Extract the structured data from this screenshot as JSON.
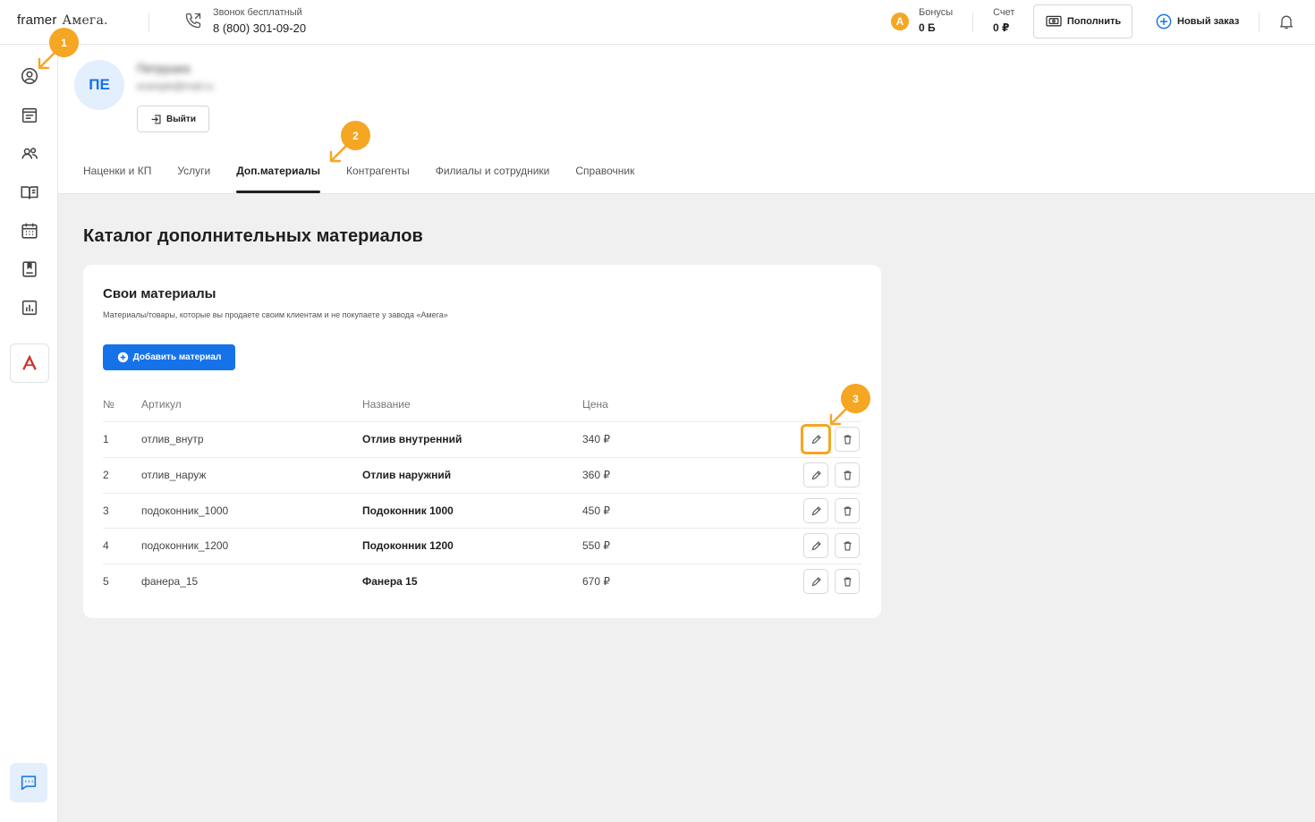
{
  "header": {
    "logo_brand": "framer",
    "logo_partner": "Амега.",
    "phone_label": "Звонок бесплатный",
    "phone_number": "8 (800) 301-09-20",
    "bonus_badge": "А",
    "bonus_label": "Бонусы",
    "bonus_value": "0 Б",
    "account_label": "Счет",
    "account_value": "0 ₽",
    "topup_label": "Пополнить",
    "new_order_label": "Новый заказ"
  },
  "sidebar": {
    "items": [
      "user-circle-icon",
      "order-list-icon",
      "users-icon",
      "catalog-book-icon",
      "calendar-icon",
      "bookmark-icon",
      "bar-chart-icon"
    ],
    "brand_letter": "A",
    "chat": "chat-icon"
  },
  "profile": {
    "initials": "ПЕ",
    "name": "Петрушка",
    "email": "example@mail.ru",
    "logout_label": "Выйти"
  },
  "tabs": [
    {
      "label": "Наценки и КП",
      "active": false
    },
    {
      "label": "Услуги",
      "active": false
    },
    {
      "label": "Доп.материалы",
      "active": true
    },
    {
      "label": "Контрагенты",
      "active": false
    },
    {
      "label": "Филиалы и сотрудники",
      "active": false
    },
    {
      "label": "Справочник",
      "active": false
    }
  ],
  "main": {
    "page_title": "Каталог дополнительных материалов",
    "card_title": "Свои материалы",
    "card_subtitle": "Материалы/товары, которые вы продаете своим клиентам и не покупаете у завода «Амега»",
    "add_button": "Добавить материал",
    "columns": [
      "№",
      "Артикул",
      "Название",
      "Цена"
    ],
    "rows": [
      {
        "num": "1",
        "sku": "отлив_внутр",
        "name": "Отлив внутренний",
        "price": "340 ₽"
      },
      {
        "num": "2",
        "sku": "отлив_наруж",
        "name": "Отлив наружний",
        "price": "360 ₽"
      },
      {
        "num": "3",
        "sku": "подоконник_1000",
        "name": "Подоконник 1000",
        "price": "450 ₽"
      },
      {
        "num": "4",
        "sku": "подоконник_1200",
        "name": "Подоконник 1200",
        "price": "550 ₽"
      },
      {
        "num": "5",
        "sku": "фанера_15",
        "name": "Фанера 15",
        "price": "670 ₽"
      }
    ]
  },
  "markers": [
    "1",
    "2",
    "3"
  ],
  "colors": {
    "accent": "#1672e8",
    "marker": "#f5a623",
    "avatar_bg": "#e3effd",
    "brand_red": "#d0302f"
  }
}
